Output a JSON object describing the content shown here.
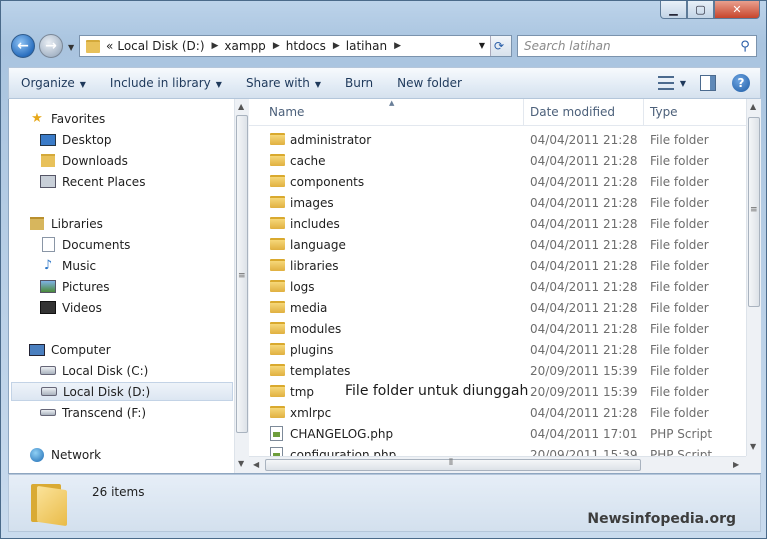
{
  "address": {
    "overflow": "«",
    "segments": [
      "Local Disk (D:)",
      "xampp",
      "htdocs",
      "latihan"
    ]
  },
  "search": {
    "placeholder": "Search latihan"
  },
  "toolbar": {
    "organize": "Organize",
    "include": "Include in library",
    "share": "Share with",
    "burn": "Burn",
    "new_folder": "New folder"
  },
  "nav": {
    "favorites": "Favorites",
    "desktop": "Desktop",
    "downloads": "Downloads",
    "recent": "Recent Places",
    "libraries": "Libraries",
    "documents": "Documents",
    "music": "Music",
    "pictures": "Pictures",
    "videos": "Videos",
    "computer": "Computer",
    "local_c": "Local Disk (C:)",
    "local_d": "Local Disk (D:)",
    "transcend": "Transcend (F:)",
    "network": "Network"
  },
  "columns": {
    "name": "Name",
    "date": "Date modified",
    "type": "Type"
  },
  "files": [
    {
      "name": "administrator",
      "date": "04/04/2011 21:28",
      "type": "File folder",
      "kind": "folder"
    },
    {
      "name": "cache",
      "date": "04/04/2011 21:28",
      "type": "File folder",
      "kind": "folder"
    },
    {
      "name": "components",
      "date": "04/04/2011 21:28",
      "type": "File folder",
      "kind": "folder"
    },
    {
      "name": "images",
      "date": "04/04/2011 21:28",
      "type": "File folder",
      "kind": "folder"
    },
    {
      "name": "includes",
      "date": "04/04/2011 21:28",
      "type": "File folder",
      "kind": "folder"
    },
    {
      "name": "language",
      "date": "04/04/2011 21:28",
      "type": "File folder",
      "kind": "folder"
    },
    {
      "name": "libraries",
      "date": "04/04/2011 21:28",
      "type": "File folder",
      "kind": "folder"
    },
    {
      "name": "logs",
      "date": "04/04/2011 21:28",
      "type": "File folder",
      "kind": "folder"
    },
    {
      "name": "media",
      "date": "04/04/2011 21:28",
      "type": "File folder",
      "kind": "folder"
    },
    {
      "name": "modules",
      "date": "04/04/2011 21:28",
      "type": "File folder",
      "kind": "folder"
    },
    {
      "name": "plugins",
      "date": "04/04/2011 21:28",
      "type": "File folder",
      "kind": "folder"
    },
    {
      "name": "templates",
      "date": "20/09/2011 15:39",
      "type": "File folder",
      "kind": "folder"
    },
    {
      "name": "tmp",
      "date": "20/09/2011 15:39",
      "type": "File folder",
      "kind": "folder"
    },
    {
      "name": "xmlrpc",
      "date": "04/04/2011 21:28",
      "type": "File folder",
      "kind": "folder"
    },
    {
      "name": "CHANGELOG.php",
      "date": "04/04/2011 17:01",
      "type": "PHP Script",
      "kind": "php"
    },
    {
      "name": "configuration.php",
      "date": "20/09/2011 15:39",
      "type": "PHP Script",
      "kind": "php"
    }
  ],
  "annotation": "File folder untuk diunggah",
  "status": {
    "count": "26 items"
  },
  "watermark": "Newsinfopedia.org"
}
